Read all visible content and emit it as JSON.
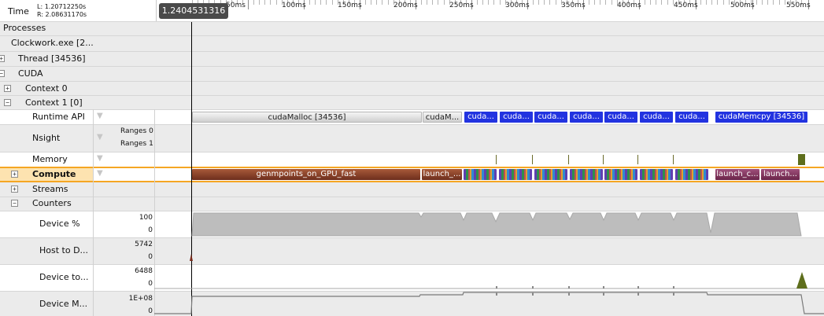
{
  "header": {
    "time_label": "Time",
    "range_left": "L: 1.20712250s",
    "range_right": "R: 2.08631170s",
    "cursor_value": "1.2404531316",
    "ticks": [
      "50ms",
      "100ms",
      "150ms",
      "200ms",
      "250ms",
      "300ms",
      "350ms",
      "400ms",
      "450ms",
      "500ms",
      "550ms"
    ]
  },
  "tree": {
    "processes": "Processes",
    "clockwork": "Clockwork.exe [2...",
    "thread": "Thread [34536]",
    "cuda": "CUDA",
    "context0": "Context 0",
    "context1": "Context 1 [0]",
    "runtime_api": "Runtime API",
    "nsight": "Nsight",
    "nsight_ranges0": "Ranges 0",
    "nsight_ranges1": "Ranges 1",
    "memory": "Memory",
    "compute": "Compute",
    "streams": "Streams",
    "counters": "Counters",
    "device_pct": "Device %",
    "host_to_device": "Host to D...",
    "device_to_host": "Device to...",
    "device_mem": "Device M..."
  },
  "expander_symbols": {
    "plus": "+",
    "minus": "−"
  },
  "counter_scales": {
    "device_pct_max": "100",
    "device_pct_min": "0",
    "h2d_max": "5742",
    "h2d_min": "0",
    "d2h_max": "6488",
    "d2h_min": "0",
    "mem_max": "1E+08",
    "mem_min": "0"
  },
  "runtime_bars": [
    {
      "label": "cudaMalloc [34536]",
      "style": "ganttgray"
    },
    {
      "label": "cudaM...",
      "style": "ganttgray"
    },
    {
      "label": "cuda...",
      "style": "blue"
    },
    {
      "label": "cuda...",
      "style": "blue"
    },
    {
      "label": "cuda...",
      "style": "blue"
    },
    {
      "label": "cuda...",
      "style": "blue"
    },
    {
      "label": "cuda...",
      "style": "blue"
    },
    {
      "label": "cuda...",
      "style": "blue"
    },
    {
      "label": "cuda...",
      "style": "blue"
    },
    {
      "label": "cudaMemcpy [34536]",
      "style": "blue"
    }
  ],
  "compute_bars": [
    {
      "label": "genmpoints_on_GPU_fast",
      "style": "brown"
    },
    {
      "label": "launch_...",
      "style": "brown"
    },
    {
      "label": "",
      "style": "rainbow"
    },
    {
      "label": "",
      "style": "rainbow"
    },
    {
      "label": "",
      "style": "rainbow"
    },
    {
      "label": "",
      "style": "rainbow"
    },
    {
      "label": "",
      "style": "rainbow"
    },
    {
      "label": "",
      "style": "rainbow"
    },
    {
      "label": "",
      "style": "rainbow"
    },
    {
      "label": "launch_c...",
      "style": "purple"
    },
    {
      "label": "launch...",
      "style": "purple"
    }
  ],
  "colors": {
    "compute_highlight": "#f5a623",
    "compute_label_bg": "#fde3b0",
    "cuda_api_blue": "#2233e0",
    "counter_fill": "#bdbdbd",
    "transfer_green": "#5e6e1c",
    "transfer_red": "#7a2a1a"
  }
}
